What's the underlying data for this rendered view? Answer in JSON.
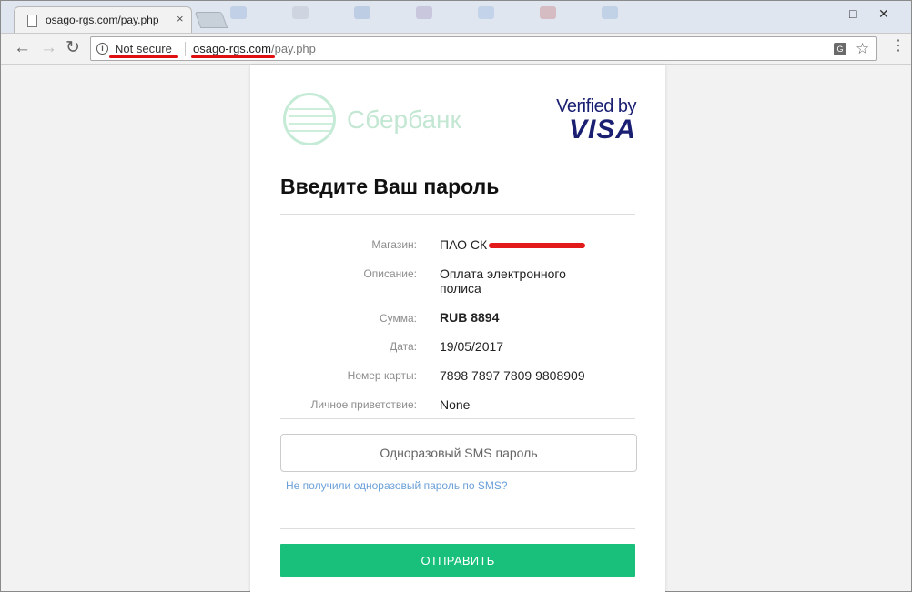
{
  "browser": {
    "tab_title": "osago-rgs.com/pay.php",
    "tab_close": "×",
    "security_label": "Not secure",
    "url_host": "osago-rgs.com",
    "url_path": "/pay.php",
    "icons": {
      "back": "back-arrow-icon",
      "forward": "forward-arrow-icon",
      "reload": "reload-icon",
      "info": "info-icon",
      "translate": "translate-icon",
      "bookmark": "star-icon",
      "menu": "kebab-menu-icon"
    },
    "annotation_color": "#e01010"
  },
  "page": {
    "bank_logo_text": "Сбербанк",
    "verified_by": "Verified by",
    "visa": "VISA",
    "heading": "Введите Ваш пароль",
    "rows": [
      {
        "label": "Магазин:",
        "value": "ПАО СК"
      },
      {
        "label": "Описание:",
        "value": "Оплата электронного полиса"
      },
      {
        "label": "Сумма:",
        "value": "RUB 8894"
      },
      {
        "label": "Дата:",
        "value": "19/05/2017"
      },
      {
        "label": "Номер карты:",
        "value": "7898 7897 7809 9808909"
      },
      {
        "label": "Личное приветствие:",
        "value": "None"
      }
    ],
    "sms_placeholder": "Одноразовый SMS пароль",
    "sms_link": "Не получили одноразовый пароль по SMS?",
    "submit_label": "ОТПРАВИТЬ",
    "colors": {
      "submit": "#19c07b",
      "link": "#6a9fd8",
      "visa": "#1a1f71",
      "sber": "#7ccca0"
    }
  }
}
